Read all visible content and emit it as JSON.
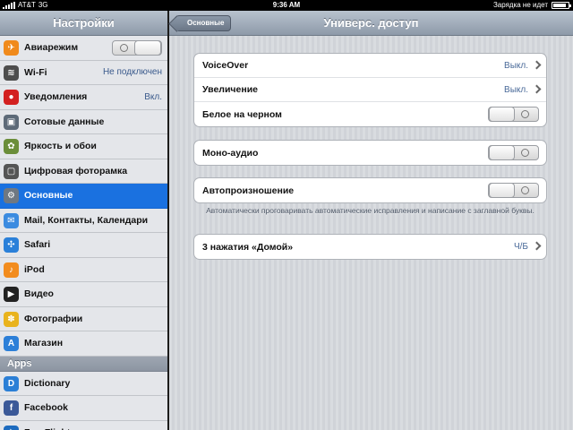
{
  "status_bar": {
    "carrier": "AT&T",
    "network": "3G",
    "time": "9:36 AM",
    "charging": "Зарядка не идет",
    "battery_level": 0.85
  },
  "master": {
    "title": "Настройки",
    "items": [
      {
        "label": "Авиарежим",
        "icon": "airplane-icon",
        "color": "#f08a1c",
        "glyph": "✈",
        "toggle": true
      },
      {
        "label": "Wi-Fi",
        "icon": "wifi-icon",
        "color": "#4d4d4d",
        "glyph": "≋",
        "value": "Не подключен"
      },
      {
        "label": "Уведомления",
        "icon": "notifications-icon",
        "color": "#d32020",
        "glyph": "●",
        "value": "Вкл."
      },
      {
        "label": "Сотовые данные",
        "icon": "cellular-icon",
        "color": "#5d6a78",
        "glyph": "▣"
      },
      {
        "label": "Яркость и обои",
        "icon": "brightness-icon",
        "color": "#6b8e3a",
        "glyph": "✿"
      },
      {
        "label": "Цифровая фоторамка",
        "icon": "picture-frame-icon",
        "color": "#555555",
        "glyph": "▢"
      },
      {
        "label": "Основные",
        "icon": "gear-icon",
        "color": "#6f7882",
        "glyph": "⚙",
        "selected": true
      },
      {
        "label": "Mail, Контакты, Календари",
        "icon": "mail-icon",
        "color": "#3b8be0",
        "glyph": "✉"
      },
      {
        "label": "Safari",
        "icon": "compass-icon",
        "color": "#2a80d9",
        "glyph": "✣"
      },
      {
        "label": "iPod",
        "icon": "ipod-icon",
        "color": "#f28c1e",
        "glyph": "♪"
      },
      {
        "label": "Видео",
        "icon": "video-icon",
        "color": "#222222",
        "glyph": "▶"
      },
      {
        "label": "Фотографии",
        "icon": "sunflower-icon",
        "color": "#e9b31d",
        "glyph": "✽"
      },
      {
        "label": "Магазин",
        "icon": "store-icon",
        "color": "#2c7fd8",
        "glyph": "A"
      }
    ],
    "section_header": "Apps",
    "apps": [
      {
        "label": "Dictionary",
        "icon": "dictionary-icon",
        "color": "#2b7fd6",
        "glyph": "D"
      },
      {
        "label": "Facebook",
        "icon": "facebook-icon",
        "color": "#3b5998",
        "glyph": "f"
      },
      {
        "label": "ForeFlight",
        "icon": "foreflight-icon",
        "color": "#1d6bbf",
        "glyph": "✈"
      }
    ]
  },
  "detail": {
    "back_label": "Основные",
    "title": "Универс. доступ",
    "group1": [
      {
        "label": "VoiceOver",
        "value": "Выкл.",
        "chevron": true
      },
      {
        "label": "Увеличение",
        "value": "Выкл.",
        "chevron": true
      },
      {
        "label": "Белое на черном",
        "toggle": true
      }
    ],
    "group2": [
      {
        "label": "Моно-аудио",
        "toggle": true
      }
    ],
    "group3": [
      {
        "label": "Автопроизношение",
        "toggle": true
      }
    ],
    "footnote": "Автоматически проговаривать автоматические исправления и написание с заглавной буквы.",
    "group4": [
      {
        "label": "3 нажатия «Домой»",
        "value": "Ч/Б",
        "chevron": true
      }
    ]
  }
}
